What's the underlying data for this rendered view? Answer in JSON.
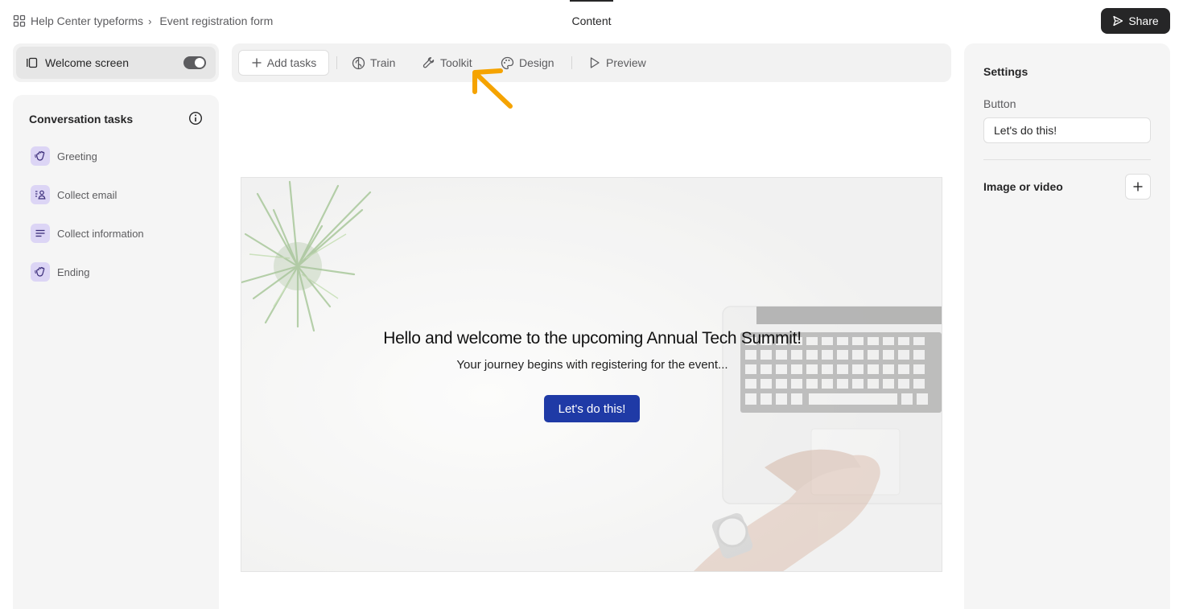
{
  "breadcrumb": {
    "workspace": "Help Center typeforms",
    "form": "Event registration form"
  },
  "header": {
    "active_tab": "Content",
    "share_label": "Share"
  },
  "welcome": {
    "label": "Welcome screen",
    "enabled": true
  },
  "tasks": {
    "title": "Conversation tasks",
    "items": [
      {
        "label": "Greeting",
        "icon": "wave-hand-icon"
      },
      {
        "label": "Collect email",
        "icon": "contact-card-icon"
      },
      {
        "label": "Collect information",
        "icon": "lines-icon"
      },
      {
        "label": "Ending",
        "icon": "wave-hand-icon"
      }
    ]
  },
  "toolbar": {
    "add_tasks": "Add tasks",
    "train": "Train",
    "toolkit": "Toolkit",
    "design": "Design",
    "preview": "Preview"
  },
  "preview": {
    "title": "Hello and welcome to the upcoming Annual Tech Summit!",
    "subtitle": "Your journey begins with registering for the event...",
    "button": "Let's do this!",
    "button_color": "#1f3aa6"
  },
  "settings": {
    "title": "Settings",
    "button_label": "Button",
    "button_value": "Let's do this!",
    "media_label": "Image or video"
  },
  "colors": {
    "accent_dark": "#262627",
    "annotation": "#f5a300",
    "task_icon_bg": "#dcd5f5"
  }
}
